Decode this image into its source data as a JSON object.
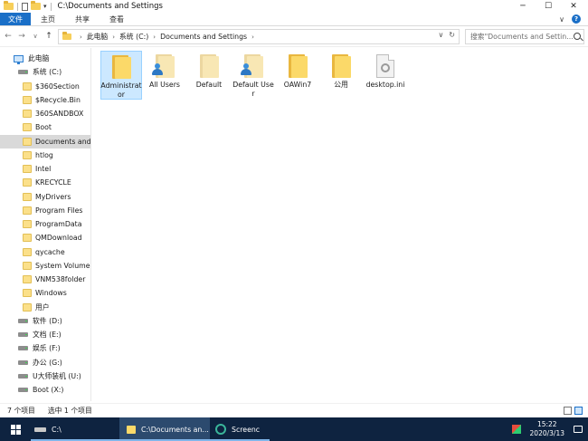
{
  "window": {
    "title": "C:\\Documents and Settings",
    "controls": {
      "minimize": "─",
      "maximize": "☐",
      "close": "✕"
    }
  },
  "ribbon": {
    "tabs": [
      {
        "label": "文件"
      },
      {
        "label": "主页"
      },
      {
        "label": "共享"
      },
      {
        "label": "查看"
      }
    ],
    "expand_glyph": "∨",
    "help_glyph": "?"
  },
  "address": {
    "back": "←",
    "forward": "→",
    "recent": "∨",
    "up": "↑",
    "crumbs": [
      "此电脑",
      "系统 (C:)",
      "Documents and Settings"
    ],
    "dropdown_glyph": "∨",
    "refresh_glyph": "↻"
  },
  "search": {
    "placeholder": "搜索\"Documents and Settin..."
  },
  "navpane": {
    "items": [
      {
        "label": "此电脑",
        "icon": "pc-icon"
      },
      {
        "label": "系统 (C:)",
        "icon": "drive-icon"
      },
      {
        "label": "$360Section",
        "icon": "folder-icon"
      },
      {
        "label": "$Recycle.Bin",
        "icon": "folder-icon"
      },
      {
        "label": "360SANDBOX",
        "icon": "folder-icon"
      },
      {
        "label": "Boot",
        "icon": "folder-icon"
      },
      {
        "label": "Documents and",
        "icon": "folder-icon"
      },
      {
        "label": "htlog",
        "icon": "folder-icon"
      },
      {
        "label": "Intel",
        "icon": "folder-icon"
      },
      {
        "label": "KRECYCLE",
        "icon": "folder-icon"
      },
      {
        "label": "MyDrivers",
        "icon": "folder-icon"
      },
      {
        "label": "Program Files",
        "icon": "folder-icon"
      },
      {
        "label": "ProgramData",
        "icon": "folder-icon"
      },
      {
        "label": "QMDownload",
        "icon": "folder-icon"
      },
      {
        "label": "qycache",
        "icon": "folder-icon"
      },
      {
        "label": "System Volume I",
        "icon": "folder-icon"
      },
      {
        "label": "VNM538folder",
        "icon": "folder-icon"
      },
      {
        "label": "Windows",
        "icon": "folder-icon"
      },
      {
        "label": "用户",
        "icon": "folder-icon"
      },
      {
        "label": "软件 (D:)",
        "icon": "drive-icon"
      },
      {
        "label": "文档 (E:)",
        "icon": "drive-icon"
      },
      {
        "label": "娱乐 (F:)",
        "icon": "drive-icon"
      },
      {
        "label": "办公 (G:)",
        "icon": "drive-icon"
      },
      {
        "label": "U大师装机 (U:)",
        "icon": "drive-icon"
      },
      {
        "label": "Boot (X:)",
        "icon": "drive-icon"
      }
    ]
  },
  "content": {
    "items": [
      {
        "label": "Administrator",
        "icon": "folder-icon"
      },
      {
        "label": "All Users",
        "icon": "user-folder-icon"
      },
      {
        "label": "Default",
        "icon": "folder-icon"
      },
      {
        "label": "Default User",
        "icon": "user-folder-icon"
      },
      {
        "label": "OAWin7",
        "icon": "folder-icon"
      },
      {
        "label": "公用",
        "icon": "folder-icon"
      },
      {
        "label": "desktop.ini",
        "icon": "settings-file-icon"
      }
    ]
  },
  "status": {
    "count": "7 个项目",
    "selected": "选中 1 个项目"
  },
  "taskbar": {
    "items": [
      {
        "label": "C:\\"
      },
      {
        "label": "C:\\Documents an..."
      },
      {
        "label": "Screenc"
      }
    ],
    "time": "15:22",
    "date": "2020/3/13"
  }
}
